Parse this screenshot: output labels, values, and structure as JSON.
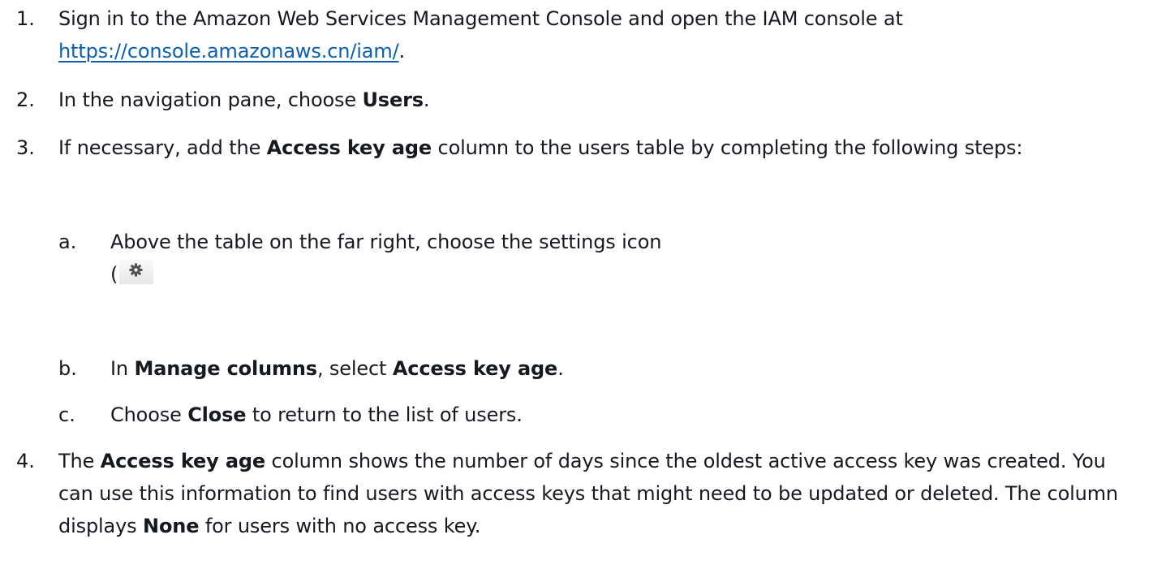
{
  "steps": [
    {
      "num": "1.",
      "text_before": "Sign in to the Amazon Web Services Management Console and open the IAM console at",
      "link": "https://console.amazonaws.cn/iam/",
      "text_after": "."
    },
    {
      "num": "2.",
      "pre": "In the navigation pane, choose ",
      "bold": "Users",
      "post": "."
    },
    {
      "num": "3.",
      "pre": "If necessary, add the ",
      "bold": "Access key age",
      "post": " column to the users table by completing the following steps:",
      "substeps": [
        {
          "num": "a.",
          "text": "Above the table on the far right, choose the settings icon",
          "paren": "(",
          "icon": "gear-icon"
        },
        {
          "num": "b.",
          "pre": "In ",
          "bold1": "Manage columns",
          "mid": ", select ",
          "bold2": "Access key age",
          "post": "."
        },
        {
          "num": "c.",
          "pre": "Choose ",
          "bold": "Close",
          "post": " to return to the list of users."
        }
      ]
    },
    {
      "num": "4.",
      "pre": "The ",
      "bold1": "Access key age",
      "mid": " column shows the number of days since the oldest active access key was created. You can use this information to find users with access keys that might need to be updated or deleted. The column displays ",
      "bold2": "None",
      "post": " for users with no access key."
    }
  ],
  "colors": {
    "text": "#16191f",
    "link": "#0d5eaf"
  }
}
